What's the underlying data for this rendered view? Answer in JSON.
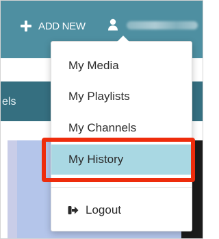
{
  "header": {
    "add_new_label": "ADD NEW",
    "add_icon": "plus-icon",
    "user_icon": "user-icon"
  },
  "subnav": {
    "partial_label": "els"
  },
  "user_menu": {
    "items": [
      {
        "label": "My Media"
      },
      {
        "label": "My Playlists"
      },
      {
        "label": "My Channels"
      },
      {
        "label": "My History",
        "highlighted": true
      }
    ],
    "logout": {
      "label": "Logout",
      "icon": "sign-out-icon"
    }
  },
  "colors": {
    "header_bg": "#4e8fa1",
    "subnav_bg": "#356f80",
    "selected_item_bg": "#a9d8e3",
    "callout_border": "#ee2c0c"
  }
}
